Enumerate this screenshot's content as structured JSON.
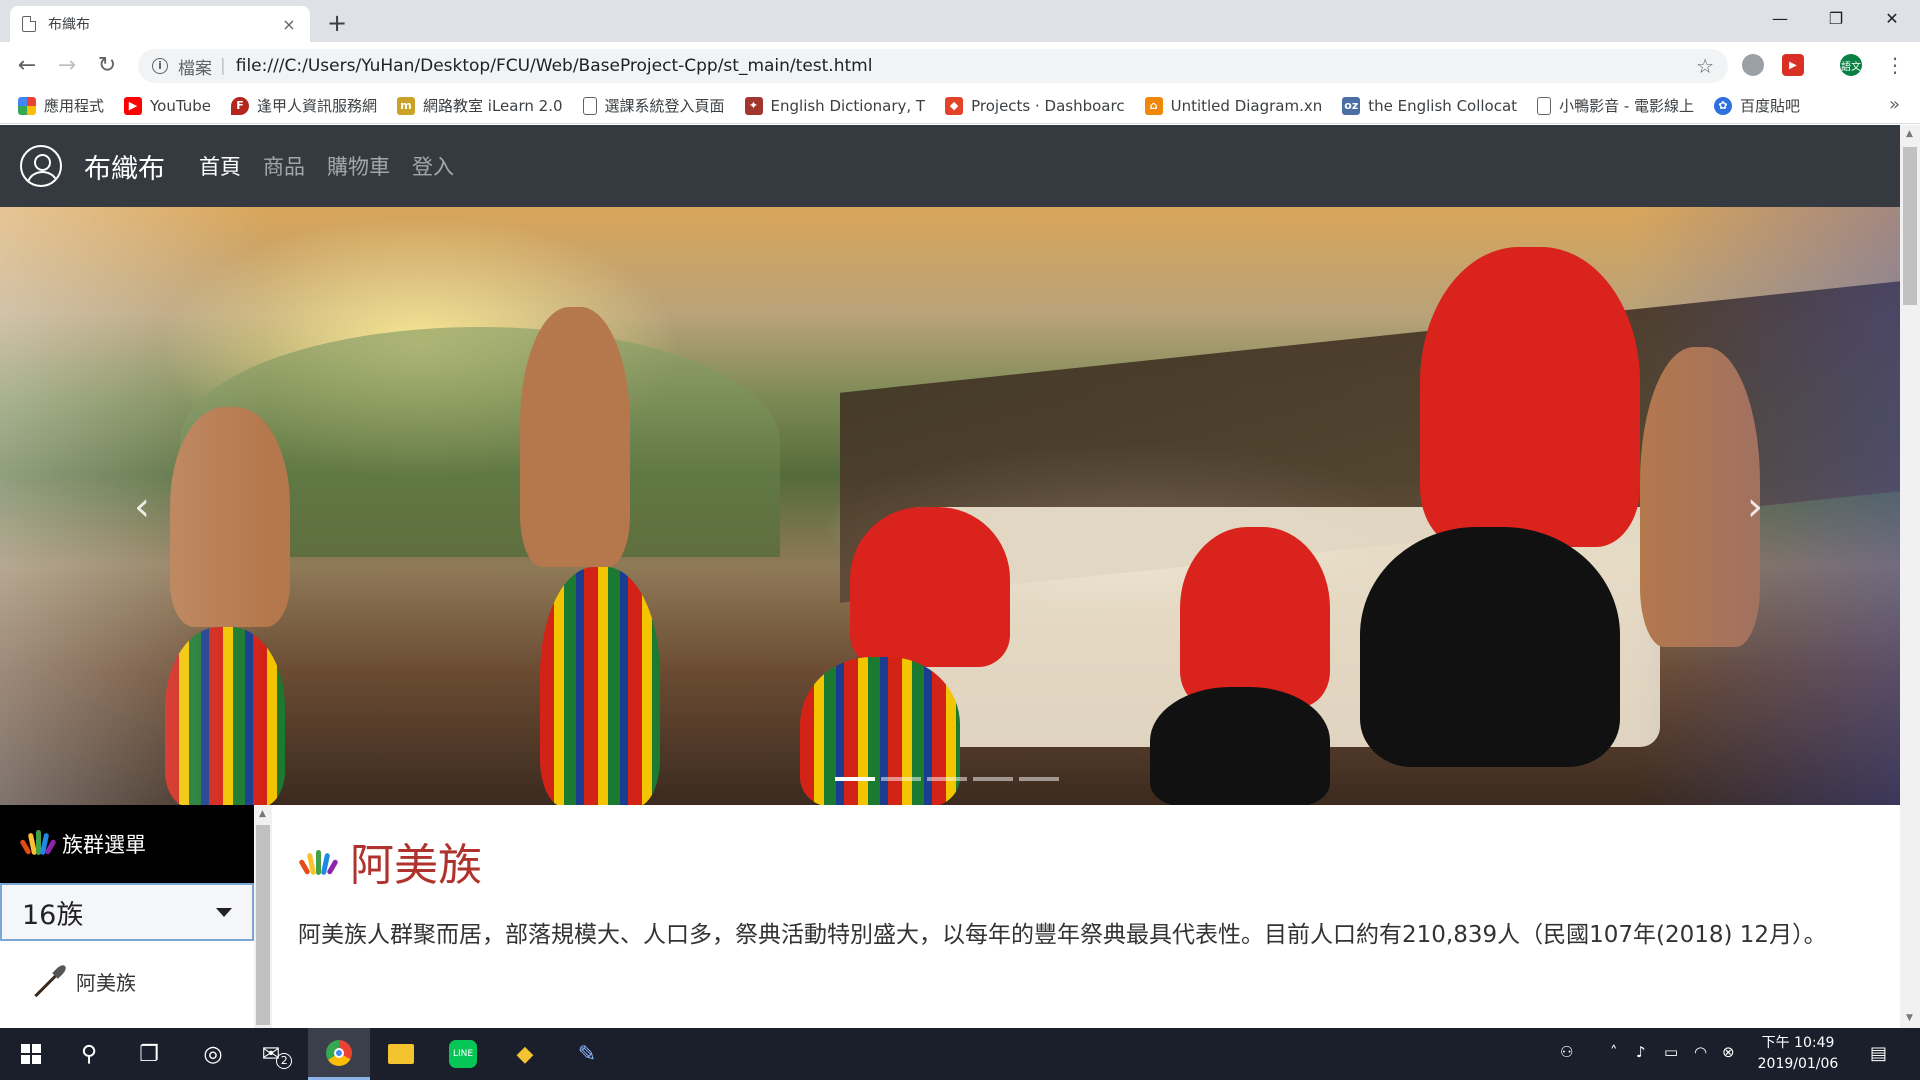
{
  "browser": {
    "tab_title": "布織布",
    "tab_close": "×",
    "new_tab": "+",
    "window_controls": [
      "—",
      "❐",
      "✕"
    ],
    "scheme_label": "檔案",
    "url": "file:///C:/Users/YuHan/Desktop/FCU/Web/BaseProject-Cpp/st_main/test.html",
    "profile_badge": "語文"
  },
  "bookmarks": [
    {
      "label": "應用程式",
      "icon": "apps-grid-icon",
      "color": "#ea4335"
    },
    {
      "label": "YouTube",
      "icon": "youtube-icon",
      "color": "#ff0000"
    },
    {
      "label": "逢甲人資訊服務網",
      "icon": "fcu-icon",
      "color": "#b3261e"
    },
    {
      "label": "網路教室 iLearn 2.0",
      "icon": "ilearn-icon",
      "color": "#c9a227"
    },
    {
      "label": "選課系統登入頁面",
      "icon": "page-icon",
      "color": "#ffffff"
    },
    {
      "label": "English Dictionary, T",
      "icon": "dictionary-icon",
      "color": "#a1362f"
    },
    {
      "label": "Projects · Dashboarc",
      "icon": "gitlab-icon",
      "color": "#e24329"
    },
    {
      "label": "Untitled Diagram.xn",
      "icon": "drawio-icon",
      "color": "#f08705"
    },
    {
      "label": "the English Collocat",
      "icon": "oz-icon",
      "color": "#4a6fa5"
    },
    {
      "label": "小鴨影音 - 電影線上",
      "icon": "page-icon",
      "color": "#ffffff"
    },
    {
      "label": "百度貼吧",
      "icon": "baidu-icon",
      "color": "#2f6fde"
    }
  ],
  "bookmarks_more": "»",
  "site": {
    "brand": "布織布",
    "nav": [
      "首頁",
      "商品",
      "購物車",
      "登入"
    ],
    "carousel": {
      "prev": "‹",
      "next": "›",
      "slides": 5,
      "active": 0
    }
  },
  "sidebar": {
    "title": "族群選單",
    "selected": "16族",
    "items": [
      "阿美族"
    ]
  },
  "content": {
    "title": "阿美族",
    "paragraph": "阿美族人群聚而居，部落規模大、人口多，祭典活動特別盛大，以每年的豐年祭典最具代表性。目前人口約有210,839人（民國107年(2018) 12月）。"
  },
  "taskbar": {
    "mail_badge": "2",
    "clock_time": "下午 10:49",
    "clock_date": "2019/01/06"
  }
}
